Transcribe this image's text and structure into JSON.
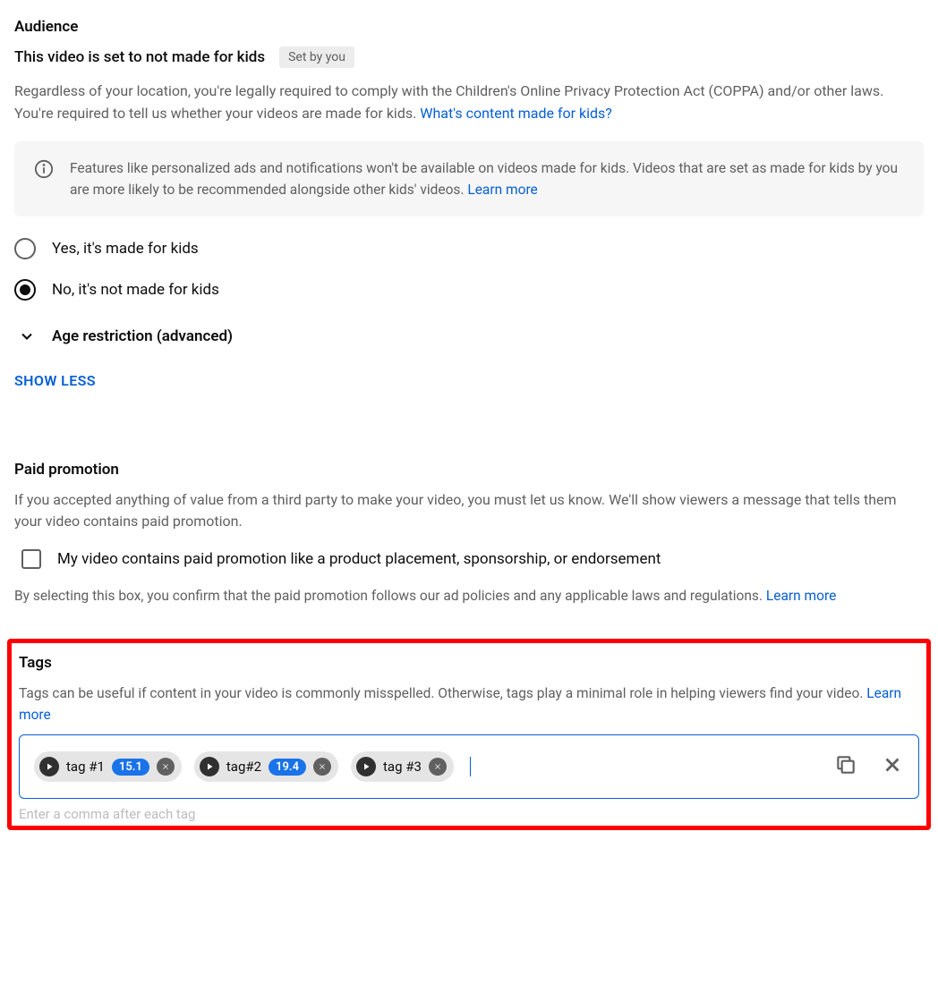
{
  "audience": {
    "title": "Audience",
    "status": "This video is set to not made for kids",
    "setBy": "Set by you",
    "desc1": "Regardless of your location, you're legally required to comply with the Children's Online Privacy Protection Act (COPPA) and/or other laws. You're required to tell us whether your videos are made for kids. ",
    "desc1Link": "What's content made for kids?",
    "infoText": "Features like personalized ads and notifications won't be available on videos made for kids. Videos that are set as made for kids by you are more likely to be recommended alongside other kids' videos. ",
    "infoLink": "Learn more",
    "radioYes": "Yes, it's made for kids",
    "radioNo": "No, it's not made for kids",
    "ageRestriction": "Age restriction (advanced)",
    "showLess": "SHOW LESS"
  },
  "paidPromo": {
    "title": "Paid promotion",
    "desc": "If you accepted anything of value from a third party to make your video, you must let us know. We'll show viewers a message that tells them your video contains paid promotion.",
    "checkboxLabel": "My video contains paid promotion like a product placement, sponsorship, or endorsement",
    "confirmText": "By selecting this box, you confirm that the paid promotion follows our ad policies and any applicable laws and regulations. ",
    "confirmLink": "Learn more"
  },
  "tags": {
    "title": "Tags",
    "desc": "Tags can be useful if content in your video is commonly misspelled. Otherwise, tags play a minimal role in helping viewers find your video. ",
    "descLink": "Learn more",
    "items": [
      {
        "label": "tag #1",
        "score": "15.1"
      },
      {
        "label": "tag#2",
        "score": "19.4"
      },
      {
        "label": "tag #3",
        "score": ""
      }
    ],
    "hint": "Enter a comma after each tag"
  }
}
